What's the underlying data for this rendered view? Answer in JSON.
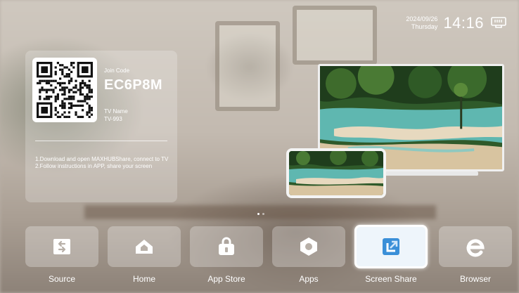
{
  "status": {
    "date": "2024/09/26",
    "weekday": "Thursday",
    "time": "14:16",
    "network_icon": "ethernet-icon"
  },
  "join": {
    "code_label": "Join Code",
    "code": "EC6P8M",
    "tv_name_label": "TV Name",
    "tv_name": "TV-993",
    "instruction_1": "1.Download and open MAXHUBShare, connect to TV",
    "instruction_2": "2.Follow instructions in APP, share your screen"
  },
  "pager": {
    "count": 2,
    "active": 0
  },
  "dock": {
    "items": [
      {
        "label": "Source",
        "icon": "source-icon"
      },
      {
        "label": "Home",
        "icon": "home-icon"
      },
      {
        "label": "App Store",
        "icon": "app-store-icon"
      },
      {
        "label": "Apps",
        "icon": "apps-icon"
      },
      {
        "label": "Screen Share",
        "icon": "screen-share-icon",
        "selected": true
      },
      {
        "label": "Browser",
        "icon": "browser-icon"
      }
    ]
  },
  "colors": {
    "accent": "#3a8fd8",
    "tile_icon": "#ffffff"
  }
}
